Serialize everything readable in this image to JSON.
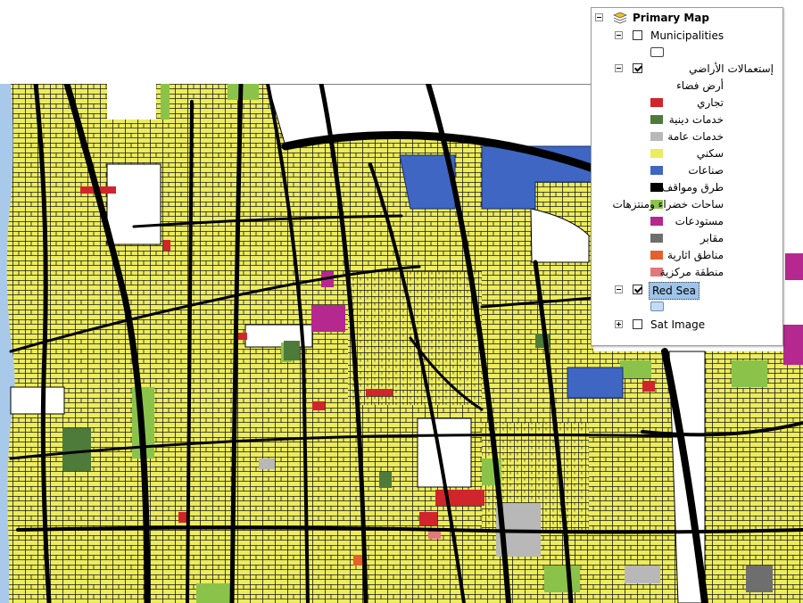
{
  "toc": {
    "root": {
      "label": "Primary Map",
      "icon": "layers-icon",
      "expanded": true
    },
    "layers": [
      {
        "id": "municipalities",
        "label": "Municipalities",
        "checked": false,
        "expanded": true,
        "symbol_color": "#ffffff"
      },
      {
        "id": "landuse",
        "label": "إستعمالات الأراضي",
        "checked": true,
        "expanded": true,
        "legend": [
          {
            "label": "أرض فضاء",
            "color": "#ffffff"
          },
          {
            "label": "تجاري",
            "color": "#d0252d"
          },
          {
            "label": "خدمات دينية",
            "color": "#4e7a3a"
          },
          {
            "label": "خدمات عامة",
            "color": "#b8b8b8"
          },
          {
            "label": "سكني",
            "color": "#ecec5e"
          },
          {
            "label": "صناعات",
            "color": "#3e66c2"
          },
          {
            "label": "طرق ومواقف",
            "color": "#000000"
          },
          {
            "label": "ساحات خضراء ومنتزهات",
            "color": "#8bc34a"
          },
          {
            "label": "مستودعات",
            "color": "#b5288f"
          },
          {
            "label": "مقابر",
            "color": "#6e6e6e"
          },
          {
            "label": "مناطق اثارية",
            "color": "#e4602c"
          },
          {
            "label": "منطقة مركزية",
            "color": "#e0787e"
          }
        ]
      },
      {
        "id": "redsea",
        "label": "Red Sea",
        "checked": true,
        "expanded": true,
        "selected": true,
        "symbol_color": "#c4dcf3"
      },
      {
        "id": "satimage",
        "label": "Sat Image",
        "checked": false,
        "expanded": false
      }
    ]
  },
  "map": {
    "sea_color": "#a9c9ea",
    "residential_color": "#ecec5e",
    "road_color": "#000000"
  }
}
